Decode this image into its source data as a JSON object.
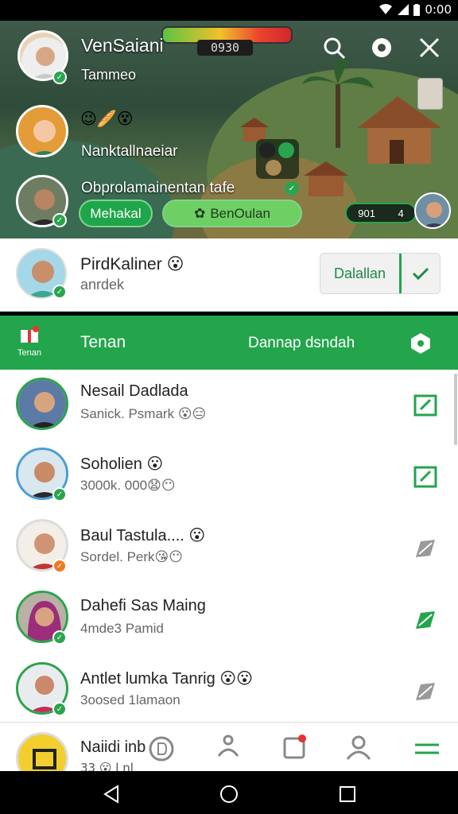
{
  "status_bar": {
    "time": "0:00"
  },
  "game": {
    "timer_text": "0930",
    "players": [
      {
        "name": "VenSaiani",
        "subtitle": "Tammeo"
      },
      {
        "name": "Nanktallnaeiar",
        "subtitle": ""
      },
      {
        "name": "Obprolamainentan tafe",
        "subtitle": ""
      }
    ],
    "buttons": {
      "left": "Mehakal",
      "right": "BenOulan"
    },
    "score_pill": "901",
    "score_pill_2": "4",
    "emojis_row1": "😉🥖😵"
  },
  "accept_row": {
    "name": "PirdKaliner",
    "emoji": "😮",
    "subtitle": "anrdek",
    "button_label": "Dalallan"
  },
  "green_bar": {
    "left_icon_label": "Tenan",
    "title": "Tenan",
    "action": "Dannap dsndah"
  },
  "contacts": [
    {
      "name": "Nesail Dadlada",
      "sub": "Sanick. Psmark",
      "emojis": "😮😑",
      "badge_color": "#2aa44d",
      "edit_color": "#22a54b"
    },
    {
      "name": "Soholien",
      "name_emoji": "😮",
      "sub": "3000k. 000",
      "emojis": "😧😶",
      "badge_color": "#2aa44d",
      "edit_color": "#22a54b"
    },
    {
      "name": "Baul Tastula....",
      "name_emoji": "😮",
      "sub": "Sordel. Perk",
      "emojis": "😘😶",
      "badge_color": "#f07a24",
      "edit_color": "#9a9a9a"
    },
    {
      "name": "Dahefi Sas Maing",
      "sub": "4mde3 Pamid",
      "emojis": "",
      "badge_color": "#2aa44d",
      "edit_color": "#22a54b"
    },
    {
      "name": "Antlet lumka Tanrig",
      "name_emoji": "😮😮",
      "sub": "3oosed 1lamaon",
      "emojis": "",
      "badge_color": "#2aa44d",
      "edit_color": "#9a9a9a"
    }
  ],
  "bottom_nav": {
    "self_name": "Naiidi inb",
    "self_sub": "33 😮 l nl"
  },
  "colors": {
    "accent": "#22a54b",
    "text": "#222222"
  },
  "icons": [
    "search-icon",
    "emoji-icon",
    "close-icon",
    "edit-icon",
    "check-icon",
    "shield-icon",
    "home-icon",
    "back-icon",
    "recents-icon"
  ]
}
